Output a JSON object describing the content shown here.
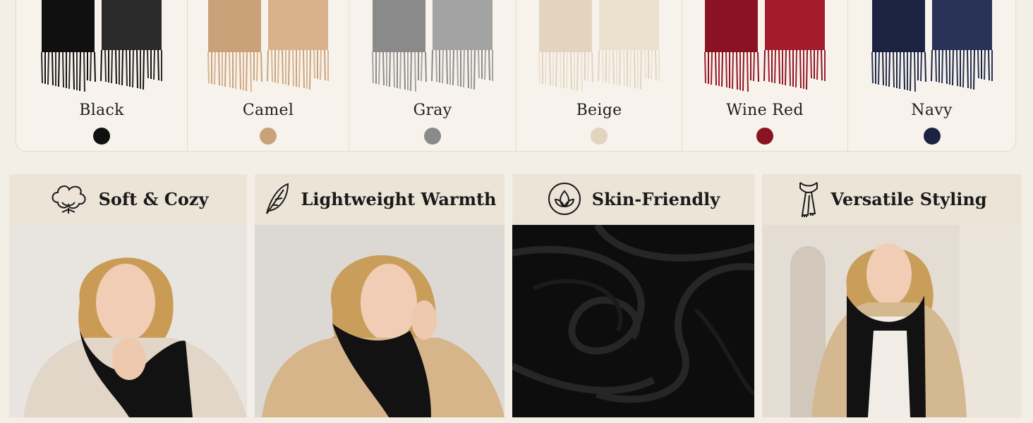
{
  "colors": [
    {
      "name": "Black",
      "hex": "#101010",
      "scarf_light": "#2a2a2a"
    },
    {
      "name": "Camel",
      "hex": "#c9a27a",
      "scarf_light": "#d9b28c"
    },
    {
      "name": "Gray",
      "hex": "#8a8a8a",
      "scarf_light": "#a3a3a3"
    },
    {
      "name": "Beige",
      "hex": "#e2d4bf",
      "scarf_light": "#ece1cf"
    },
    {
      "name": "Wine Red",
      "hex": "#8a1222",
      "scarf_light": "#a31b2c"
    },
    {
      "name": "Navy",
      "hex": "#1c2340",
      "scarf_light": "#283156"
    }
  ],
  "features": [
    {
      "title": "Soft & Cozy",
      "icon": "cotton-icon"
    },
    {
      "title": "Lightweight Warmth",
      "icon": "feather-icon"
    },
    {
      "title": "Skin-Friendly",
      "icon": "leaf-icon"
    },
    {
      "title": "Versatile Styling",
      "icon": "scarf-icon"
    }
  ]
}
